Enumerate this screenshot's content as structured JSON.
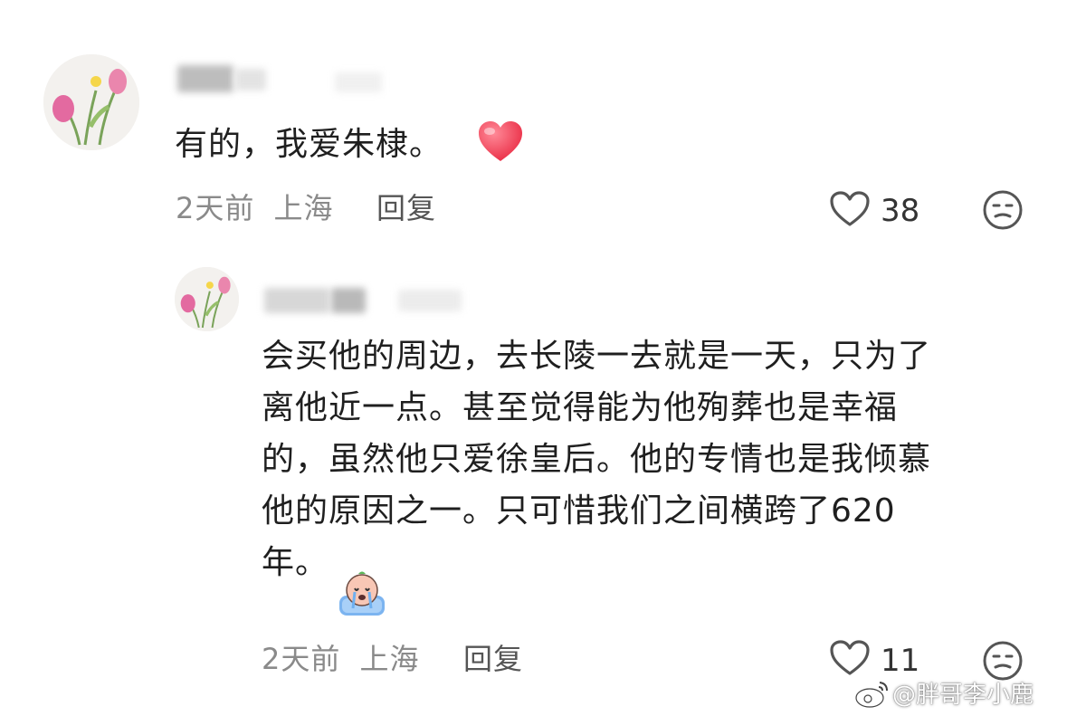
{
  "comments": [
    {
      "text": "有的，我爱朱棣。",
      "emoji": "red-heart-icon",
      "time": "2天前",
      "location": "上海",
      "reply_label": "回复",
      "likes": "38"
    },
    {
      "text_lines": [
        "会买他的周边，去长陵一去就是一天，只为了",
        "离他近一点。甚至觉得能为他殉葬也是幸福",
        "的，虽然他只爱徐皇后。他的专情也是我倾慕",
        "他的原因之一。只可惜我们之间横跨了620",
        "年。"
      ],
      "emoji": "crying-face-sticker-icon",
      "time": "2天前",
      "location": "上海",
      "reply_label": "回复",
      "likes": "11"
    }
  ],
  "watermark": "@胖哥李小鹿",
  "colors": {
    "heart": "#f0364f",
    "meta_gray": "#8a8a8a",
    "icon_gray": "#555555"
  }
}
